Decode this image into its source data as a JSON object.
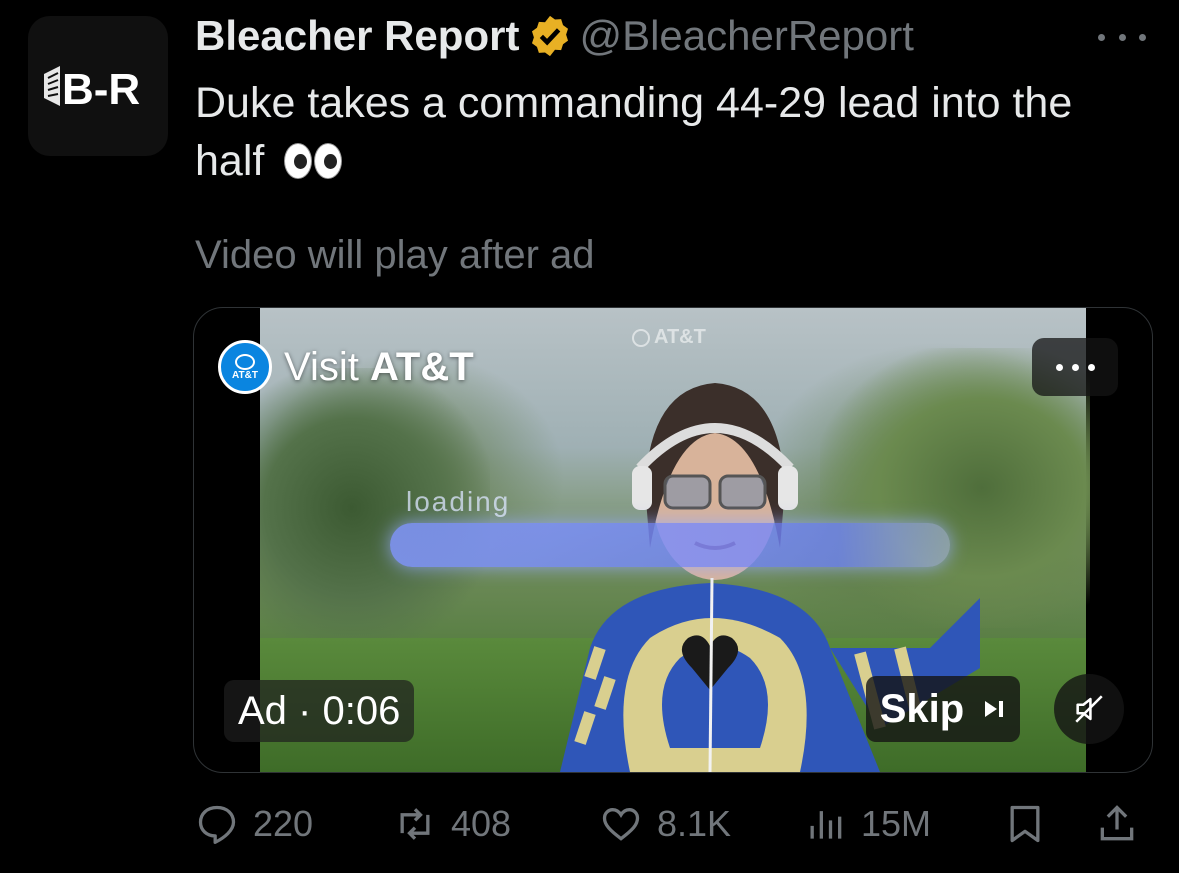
{
  "account": {
    "display_name": "Bleacher Report",
    "handle": "@BleacherReport",
    "avatar_text": "B-R",
    "verified_color": "#e8b024"
  },
  "tweet": {
    "text": "Duke takes a commanding 44-29 lead into the half",
    "emoji": "eyes"
  },
  "video_notice": "Video will play after ad",
  "ad": {
    "visit_prefix": "Visit",
    "advertiser": "AT&T",
    "logo_text": "AT&T",
    "watermark": "AT&T",
    "loading_text": "loading",
    "timer": "Ad · 0:06",
    "skip_label": "Skip"
  },
  "actions": {
    "replies": "220",
    "reposts": "408",
    "likes": "8.1K",
    "views": "15M"
  },
  "icons": [
    "more-icon",
    "verified-icon",
    "reply-icon",
    "repost-icon",
    "like-icon",
    "views-icon",
    "bookmark-icon",
    "share-icon",
    "skip-icon",
    "mute-icon",
    "ad-more-icon"
  ]
}
